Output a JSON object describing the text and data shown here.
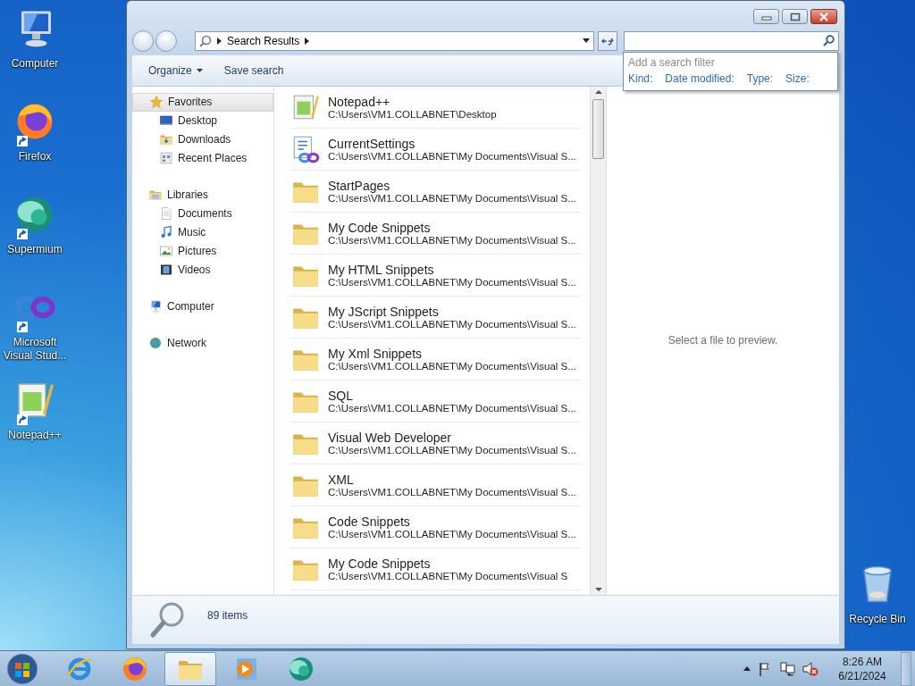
{
  "desktop_icons": [
    {
      "kind": "computer",
      "label": "Computer",
      "shortcut": false
    },
    {
      "kind": "firefox",
      "label": "Firefox",
      "shortcut": true
    },
    {
      "kind": "supermium",
      "label": "Supermium",
      "shortcut": true
    },
    {
      "kind": "visualstudio",
      "label": "Microsoft Visual Stud...",
      "shortcut": true
    },
    {
      "kind": "notepadpp",
      "label": "Notepad++",
      "shortcut": true
    }
  ],
  "recycle_bin": {
    "label": "Recycle Bin"
  },
  "window": {
    "address": {
      "crumbs": [
        "Search Results"
      ]
    },
    "search_filter": {
      "title": "Add a search filter",
      "filters": [
        "Kind:",
        "Date modified:",
        "Type:",
        "Size:"
      ]
    },
    "toolbar": [
      {
        "kind": "menu",
        "label": "Organize"
      },
      {
        "kind": "button",
        "label": "Save search"
      }
    ],
    "nav": [
      {
        "kind": "star",
        "label": "Favorites",
        "selected": true,
        "children": [
          {
            "kind": "desktop",
            "label": "Desktop",
            "selected": false
          },
          {
            "kind": "downloads",
            "label": "Downloads",
            "selected": false
          },
          {
            "kind": "recent",
            "label": "Recent Places",
            "selected": false
          }
        ]
      },
      {
        "kind": "libraries",
        "label": "Libraries",
        "selected": false,
        "children": [
          {
            "kind": "documents",
            "label": "Documents",
            "selected": false
          },
          {
            "kind": "music",
            "label": "Music",
            "selected": false
          },
          {
            "kind": "pictures",
            "label": "Pictures",
            "selected": false
          },
          {
            "kind": "videos",
            "label": "Videos",
            "selected": false
          }
        ]
      },
      {
        "kind": "computer",
        "label": "Computer",
        "selected": false
      },
      {
        "kind": "network",
        "label": "Network",
        "selected": false
      }
    ],
    "files": [
      {
        "kind": "notepad",
        "name": "Notepad++",
        "path": "C:\\Users\\VM1.COLLABNET\\Desktop"
      },
      {
        "kind": "settings",
        "name": "CurrentSettings",
        "path": "C:\\Users\\VM1.COLLABNET\\My Documents\\Visual S..."
      },
      {
        "kind": "folder",
        "name": "StartPages",
        "path": "C:\\Users\\VM1.COLLABNET\\My Documents\\Visual S..."
      },
      {
        "kind": "folder",
        "name": "My Code Snippets",
        "path": "C:\\Users\\VM1.COLLABNET\\My Documents\\Visual S..."
      },
      {
        "kind": "folder",
        "name": "My HTML Snippets",
        "path": "C:\\Users\\VM1.COLLABNET\\My Documents\\Visual S..."
      },
      {
        "kind": "folder",
        "name": "My JScript Snippets",
        "path": "C:\\Users\\VM1.COLLABNET\\My Documents\\Visual S..."
      },
      {
        "kind": "folder",
        "name": "My Xml Snippets",
        "path": "C:\\Users\\VM1.COLLABNET\\My Documents\\Visual S..."
      },
      {
        "kind": "folder",
        "name": "SQL",
        "path": "C:\\Users\\VM1.COLLABNET\\My Documents\\Visual S..."
      },
      {
        "kind": "folder",
        "name": "Visual Web Developer",
        "path": "C:\\Users\\VM1.COLLABNET\\My Documents\\Visual S..."
      },
      {
        "kind": "folder",
        "name": "XML",
        "path": "C:\\Users\\VM1.COLLABNET\\My Documents\\Visual S..."
      },
      {
        "kind": "folder",
        "name": "Code Snippets",
        "path": "C:\\Users\\VM1.COLLABNET\\My Documents\\Visual S..."
      },
      {
        "kind": "folder",
        "name": "My Code Snippets",
        "path": "C:\\Users\\VM1.COLLABNET\\My Documents\\Visual S"
      }
    ],
    "preview": {
      "message": "Select a file to preview."
    },
    "status_bar": {
      "count": "89 items"
    }
  },
  "taskbar": {
    "apps": [
      {
        "kind": "ie",
        "active": false
      },
      {
        "kind": "firefox",
        "active": false
      },
      {
        "kind": "explorer",
        "active": true
      },
      {
        "kind": "mediaplayer",
        "active": false
      },
      {
        "kind": "supermium",
        "active": false
      }
    ],
    "tray": {
      "time": "8:26 AM",
      "date": "6/21/2024"
    }
  }
}
